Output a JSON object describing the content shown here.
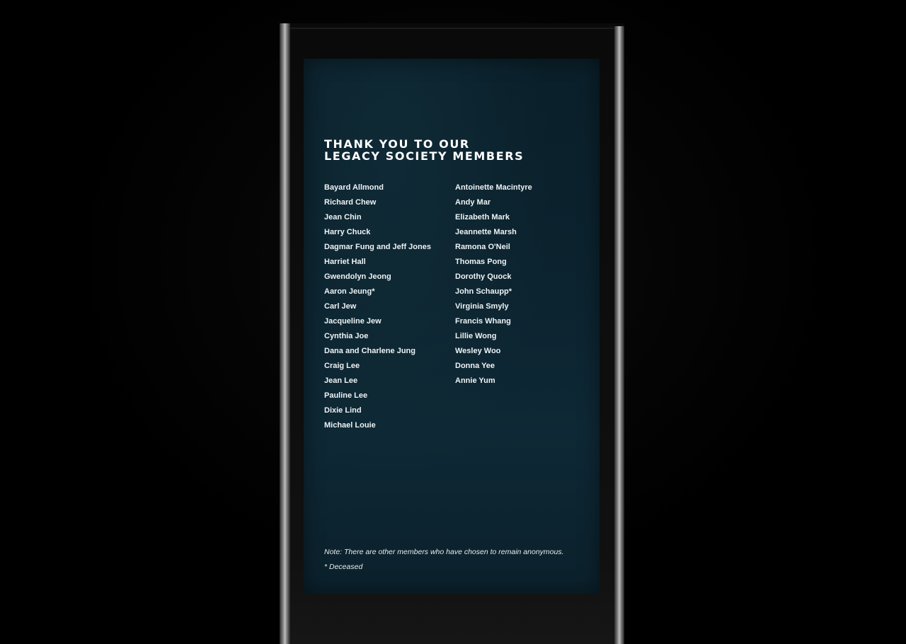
{
  "sign": {
    "title_line1": "THANK YOU TO OUR",
    "title_line2": "LEGACY SOCIETY MEMBERS",
    "members_left": [
      "Bayard Allmond",
      "Richard Chew",
      "Jean Chin",
      "Harry Chuck",
      "Dagmar Fung and Jeff Jones",
      "Harriet Hall",
      "Gwendolyn Jeong",
      "Aaron Jeung*",
      "Carl Jew",
      "Jacqueline Jew",
      "Cynthia Joe",
      "Dana and Charlene Jung",
      "Craig Lee",
      "Jean Lee",
      "Pauline Lee",
      "Dixie Lind",
      "Michael Louie"
    ],
    "members_right": [
      "Antoinette Macintyre",
      "Andy Mar",
      "Elizabeth Mark",
      "Jeannette Marsh",
      "Ramona O'Neil",
      "Thomas Pong",
      "Dorothy Quock",
      "John Schaupp*",
      "Virginia Smyly",
      "Francis Whang",
      "Lillie Wong",
      "Wesley Woo",
      "Donna Yee",
      "Annie Yum"
    ],
    "note": "Note: There are other members who have chosen to remain anonymous.",
    "deceased_note": "* Deceased"
  },
  "colors": {
    "screen_background": "#0c2430",
    "text": "#ffffff",
    "frame": "#0a0a0a",
    "posts": "#bdbdbd"
  }
}
